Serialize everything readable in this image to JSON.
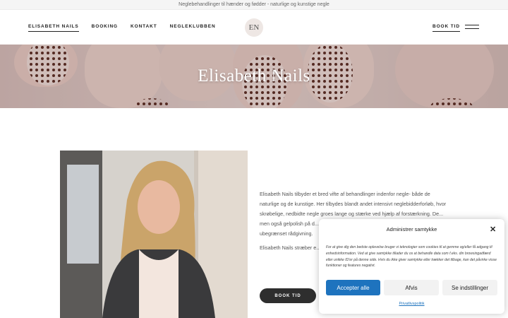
{
  "topbar": {
    "text": "Neglebehandlinger til hænder og fødder - naturlige og kunstige negle"
  },
  "nav": {
    "items": [
      {
        "label": "ELISABETH NAILS",
        "active": true
      },
      {
        "label": "BOOKING",
        "active": false
      },
      {
        "label": "KONTAKT",
        "active": false
      },
      {
        "label": "NEGLEKLUBBEN",
        "active": false
      }
    ],
    "logo_text": "EN",
    "book_label": "BOOK TID",
    "menu_icon": "hamburger-icon"
  },
  "hero": {
    "title": "Elisabeth Nails"
  },
  "about": {
    "paragraph1": "Elisabeth Nails tilbyder et bred vifte af behandlinger indenfor negle- både de naturlige og de kunstige. Her tilbydes blandt andet intensivt neglebidderforløb, hvor skrøbelige, nedbidte negle groes lange og stærke ved hjælp af forstærkning. De... men også gelpolish på d... anledning. Herudover de... neglevejledning, der kan... ubegrænset rådgivning.",
    "paragraph2": "Elisabeth Nails stræber e... behandlinger.",
    "button": "BOOK TID"
  },
  "cookie": {
    "title": "Administrer samtykke",
    "text": "For at give dig den bedste oplevelse bruger vi teknologier som cookies til at gemme og/eller få adgang til enhedsinformation. Ved at give samtykke tillader du os at behandle data som f.eks. din browsingadfærd eller unikke ID'er på denne side. Hvis du ikke giver samtykke eller trækker det tilbage, kan det påvirke visse funktioner og features negativt.",
    "accept": "Accepter alle",
    "deny": "Afvis",
    "settings": "Se indstillinger",
    "policy": "Privatlivspolitik",
    "accent": "#1e73be"
  }
}
